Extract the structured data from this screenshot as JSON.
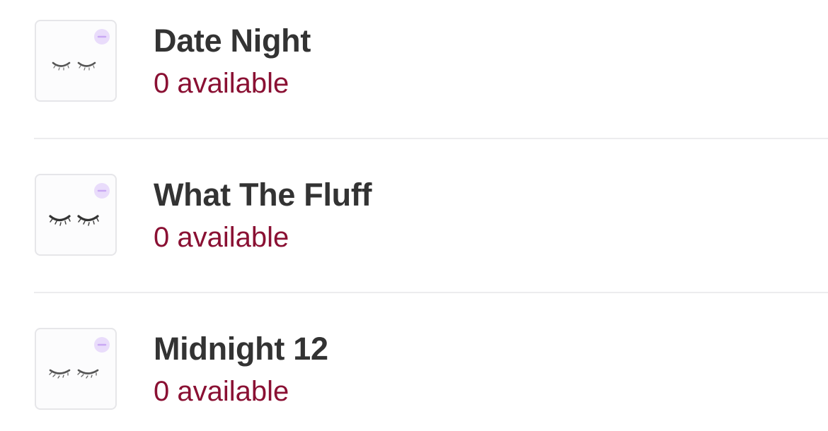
{
  "items": [
    {
      "name": "Date Night",
      "availability": "0 available",
      "icon": "closed-eyes-lashes-icon"
    },
    {
      "name": "What The Fluff",
      "availability": "0 available",
      "icon": "closed-eyes-lashes-icon"
    },
    {
      "name": "Midnight 12",
      "availability": "0 available",
      "icon": "closed-eyes-lashes-icon"
    }
  ],
  "colors": {
    "title": "#333333",
    "availability": "#8a1033",
    "badge": "#e6d5fb",
    "divider": "#ececee"
  }
}
